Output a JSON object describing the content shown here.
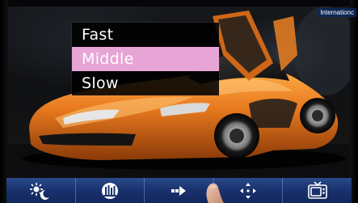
{
  "watermark": "Internationc",
  "speed_menu": {
    "items": [
      {
        "label": "Fast",
        "selected": false
      },
      {
        "label": "Middle",
        "selected": true
      },
      {
        "label": "Slow",
        "selected": false
      }
    ],
    "highlight_color": "#e7a5d6"
  },
  "toolbar": {
    "background_color": "#1a3370",
    "buttons": [
      {
        "icon": "day-night-icon"
      },
      {
        "icon": "equalizer-icon"
      },
      {
        "icon": "arrow-right-icon"
      },
      {
        "icon": "move-arrows-icon"
      },
      {
        "icon": "tv-icon"
      }
    ]
  },
  "colors": {
    "car_body": "#e8791e",
    "menu_background": "#000000"
  }
}
